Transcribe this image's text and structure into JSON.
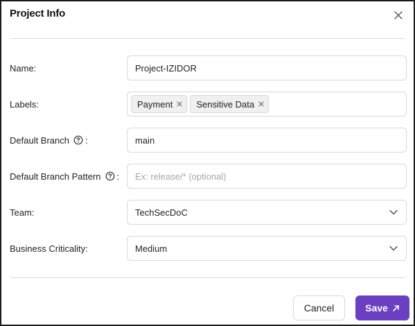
{
  "dialog": {
    "title": "Project Info",
    "close_icon": "close-icon"
  },
  "fields": {
    "name": {
      "label": "Name:",
      "value": "Project-IZIDOR"
    },
    "labels": {
      "label": "Labels:",
      "tags": [
        {
          "text": "Payment"
        },
        {
          "text": "Sensitive Data"
        }
      ]
    },
    "default_branch": {
      "label": "Default Branch",
      "value": "main",
      "icon": "help-circle-icon"
    },
    "default_branch_pattern": {
      "label": "Default Branch Pattern",
      "value": "",
      "placeholder": "Ex: release/* (optional)",
      "icon": "help-circle-icon"
    },
    "team": {
      "label": "Team:",
      "value": "TechSecDoC"
    },
    "business_criticality": {
      "label": "Business Criticality:",
      "value": "Medium"
    }
  },
  "footer": {
    "cancel_label": "Cancel",
    "save_label": "Save",
    "save_icon": "arrow-up-right-icon"
  },
  "colors": {
    "accent": "#6a3fc0",
    "border": "#d8d8d8",
    "divider": "#dcdcdc"
  }
}
